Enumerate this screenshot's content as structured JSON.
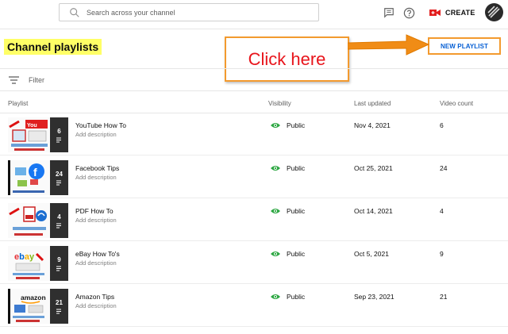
{
  "search": {
    "placeholder": "Search across your channel"
  },
  "topbar": {
    "create_label": "CREATE"
  },
  "page": {
    "title": "Channel playlists",
    "new_playlist_label": "NEW PLAYLIST"
  },
  "callout": {
    "text": "Click here"
  },
  "filter": {
    "label": "Filter"
  },
  "table": {
    "headers": {
      "playlist": "Playlist",
      "visibility": "Visibility",
      "last_updated": "Last updated",
      "video_count": "Video count"
    },
    "rows": [
      {
        "title": "YouTube How To",
        "description": "Add description",
        "count_badge": "6",
        "visibility": "Public",
        "last_updated": "Nov 4, 2021",
        "video_count": "6",
        "theme": "youtube"
      },
      {
        "title": "Facebook Tips",
        "description": "Add description",
        "count_badge": "24",
        "visibility": "Public",
        "last_updated": "Oct 25, 2021",
        "video_count": "24",
        "theme": "facebook"
      },
      {
        "title": "PDF How To",
        "description": "Add description",
        "count_badge": "4",
        "visibility": "Public",
        "last_updated": "Oct 14, 2021",
        "video_count": "4",
        "theme": "pdf"
      },
      {
        "title": "eBay How To's",
        "description": "Add description",
        "count_badge": "9",
        "visibility": "Public",
        "last_updated": "Oct 5, 2021",
        "video_count": "9",
        "theme": "ebay"
      },
      {
        "title": "Amazon Tips",
        "description": "Add description",
        "count_badge": "21",
        "visibility": "Public",
        "last_updated": "Sep 23, 2021",
        "video_count": "21",
        "theme": "amazon"
      }
    ]
  },
  "colors": {
    "accent_blue": "#065fd4",
    "callout_orange": "#f39a2e",
    "callout_text_red": "#e8141b",
    "title_highlight": "#ffff66",
    "public_green": "#2ba640"
  }
}
